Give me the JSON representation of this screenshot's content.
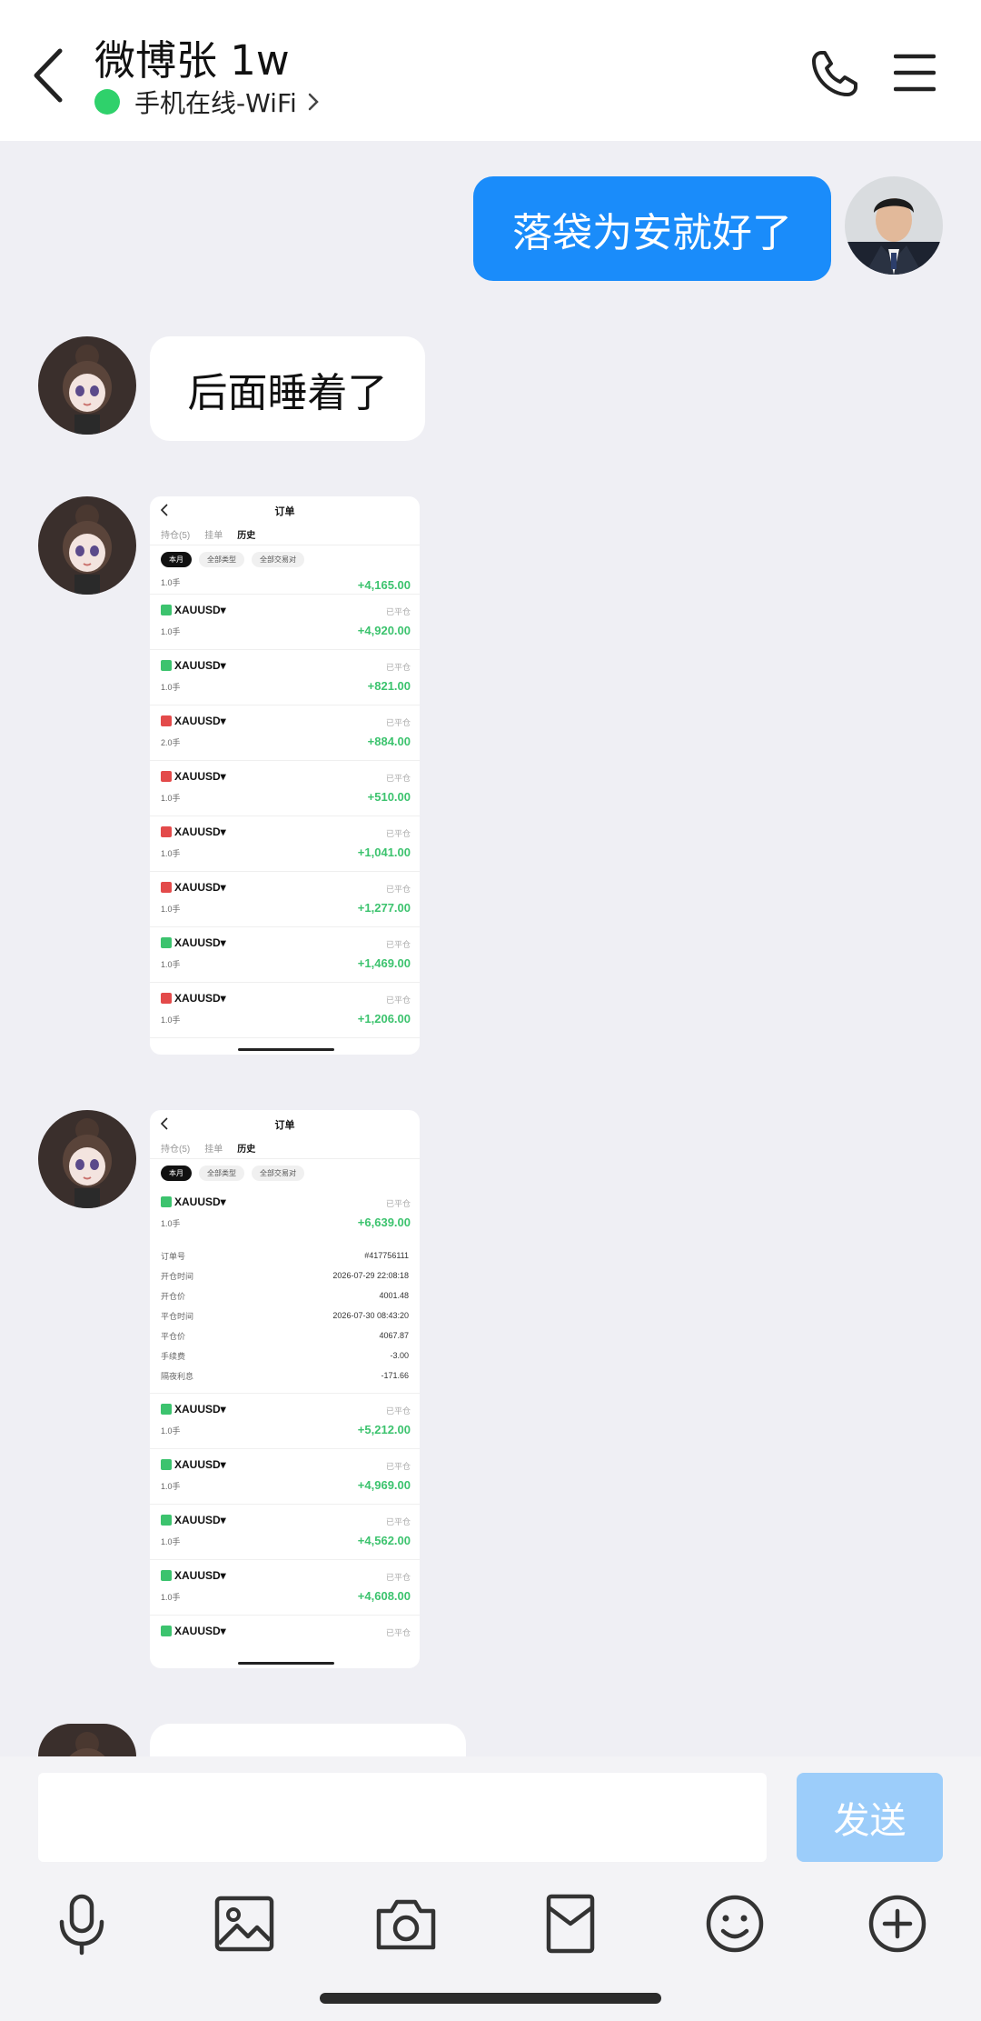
{
  "header": {
    "title": "微博张 1w",
    "status": "手机在线-WiFi"
  },
  "messages": {
    "out1": "落袋为安就好了",
    "in1": "后面睡着了"
  },
  "shot": {
    "title": "订单",
    "tabs": [
      "持仓(5)",
      "挂单",
      "历史"
    ],
    "filters": [
      "本月",
      "全部类型",
      "全部交易对"
    ]
  },
  "shot1": {
    "partial_pnl": "+4,165.00",
    "partial_lot": "1.0手",
    "rows": [
      {
        "symbol": "XAUUSD",
        "side": "g",
        "lot": "1.0手",
        "state": "已平仓",
        "pnl": "+4,920.00"
      },
      {
        "symbol": "XAUUSD",
        "side": "g",
        "lot": "1.0手",
        "state": "已平仓",
        "pnl": "+821.00"
      },
      {
        "symbol": "XAUUSD",
        "side": "r",
        "lot": "2.0手",
        "state": "已平仓",
        "pnl": "+884.00"
      },
      {
        "symbol": "XAUUSD",
        "side": "r",
        "lot": "1.0手",
        "state": "已平仓",
        "pnl": "+510.00"
      },
      {
        "symbol": "XAUUSD",
        "side": "r",
        "lot": "1.0手",
        "state": "已平仓",
        "pnl": "+1,041.00"
      },
      {
        "symbol": "XAUUSD",
        "side": "r",
        "lot": "1.0手",
        "state": "已平仓",
        "pnl": "+1,277.00"
      },
      {
        "symbol": "XAUUSD",
        "side": "g",
        "lot": "1.0手",
        "state": "已平仓",
        "pnl": "+1,469.00"
      },
      {
        "symbol": "XAUUSD",
        "side": "r",
        "lot": "1.0手",
        "state": "已平仓",
        "pnl": "+1,206.00"
      }
    ]
  },
  "shot2": {
    "first": {
      "symbol": "XAUUSD",
      "side": "g",
      "lot": "1.0手",
      "state": "已平仓",
      "pnl": "+6,639.00"
    },
    "details": [
      {
        "k": "订单号",
        "v": "#417756111"
      },
      {
        "k": "开仓时间",
        "v": "2026-07-29 22:08:18"
      },
      {
        "k": "开仓价",
        "v": "4001.48"
      },
      {
        "k": "平仓时间",
        "v": "2026-07-30 08:43:20"
      },
      {
        "k": "平仓价",
        "v": "4067.87"
      },
      {
        "k": "手续费",
        "v": "-3.00"
      },
      {
        "k": "隔夜利息",
        "v": "-171.66"
      }
    ],
    "rows": [
      {
        "symbol": "XAUUSD",
        "side": "g",
        "lot": "1.0手",
        "state": "已平仓",
        "pnl": "+5,212.00"
      },
      {
        "symbol": "XAUUSD",
        "side": "g",
        "lot": "1.0手",
        "state": "已平仓",
        "pnl": "+4,969.00"
      },
      {
        "symbol": "XAUUSD",
        "side": "g",
        "lot": "1.0手",
        "state": "已平仓",
        "pnl": "+4,562.00"
      },
      {
        "symbol": "XAUUSD",
        "side": "g",
        "lot": "1.0手",
        "state": "已平仓",
        "pnl": "+4,608.00"
      },
      {
        "symbol": "XAUUSD",
        "side": "g",
        "lot": "",
        "state": "已平仓",
        "pnl": ""
      }
    ]
  },
  "input": {
    "send_label": "发送",
    "placeholder": ""
  },
  "toolbar": {
    "icons": [
      "microphone-icon",
      "image-icon",
      "camera-icon",
      "red-packet-icon",
      "emoji-icon",
      "plus-icon"
    ]
  },
  "colors": {
    "accent": "#1a8cfa",
    "online": "#2fd16b",
    "profit": "#3cc36e",
    "sell": "#e34a4a"
  }
}
